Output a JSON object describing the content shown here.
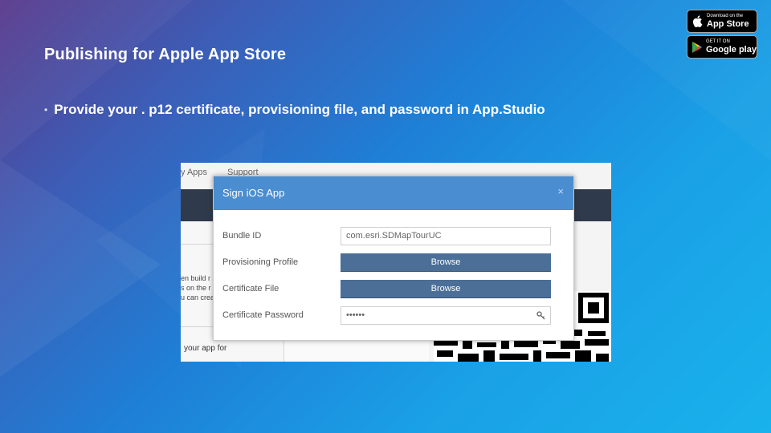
{
  "slide": {
    "title": "Publishing for Apple App Store",
    "bullet": "Provide your . p12 certificate, provisioning file, and password in App.Studio",
    "bullet_marker": "•"
  },
  "badges": {
    "app_store": {
      "small": "Download on the",
      "big": "App Store",
      "icon": "apple-icon"
    },
    "google_play": {
      "small": "GET IT ON",
      "big": "Google play",
      "icon": "play-icon"
    }
  },
  "background_screen": {
    "nav": [
      "y Apps",
      "Support"
    ],
    "left_text": [
      "en build r",
      "s on the r",
      "u can crea"
    ],
    "bottom_text": "your app for"
  },
  "dialog": {
    "title": "Sign iOS App",
    "close": "×",
    "fields": {
      "bundle_id": {
        "label": "Bundle ID",
        "value": "com.esri.SDMapTourUC"
      },
      "provisioning_profile": {
        "label": "Provisioning Profile",
        "button": "Browse"
      },
      "certificate_file": {
        "label": "Certificate File",
        "button": "Browse"
      },
      "certificate_password": {
        "label": "Certificate Password",
        "value": "••••••"
      }
    }
  },
  "colors": {
    "dialog_header": "#4a8dd0",
    "browse_button": "#4b6f97",
    "dark_bar": "#2f3b4c"
  }
}
